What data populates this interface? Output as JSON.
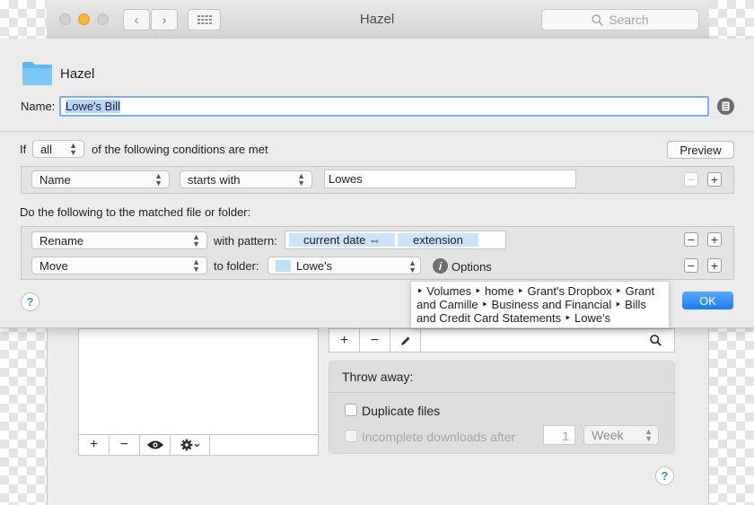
{
  "window": {
    "title": "Hazel",
    "search_placeholder": "Search",
    "nav_back": "‹",
    "nav_forward": "›"
  },
  "lower": {
    "throw_title": "Throw away:",
    "duplicate_label": "Duplicate files",
    "incomplete_label": "Incomplete downloads after",
    "incomplete_value": "1",
    "period_value": "Week",
    "toolbar_add": "+",
    "toolbar_remove": "−"
  },
  "sheet": {
    "title": "Hazel",
    "name_label": "Name:",
    "name_value": "Lowe's Bill",
    "if_label": "If",
    "match_value": "all",
    "conditions_text": "of the following conditions are met",
    "preview_label": "Preview",
    "condition": {
      "attribute": "Name",
      "operator": "starts with",
      "value": "Lowes"
    },
    "actions_heading": "Do the following to the matched file or folder:",
    "action1": {
      "type": "Rename",
      "with_label": "with pattern:",
      "tokens": [
        "current date ⇔",
        "extension"
      ]
    },
    "action2": {
      "type": "Move",
      "to_label": "to folder:",
      "folder": "Lowe's",
      "options_label": "Options"
    },
    "tooltip_path": "‣ Volumes ‣ home ‣ Grant's Dropbox ‣ Grant and Camille ‣ Business and Financial ‣ Bills and Credit Card Statements ‣ Lowe's",
    "ok_label": "OK",
    "help_label": "?",
    "plus": "+",
    "minus": "−"
  },
  "colors": {
    "accent": "#1b7cf0",
    "selection": "#b5d5ff",
    "token": "#cde3fa",
    "folder": "#7ec8f5"
  }
}
